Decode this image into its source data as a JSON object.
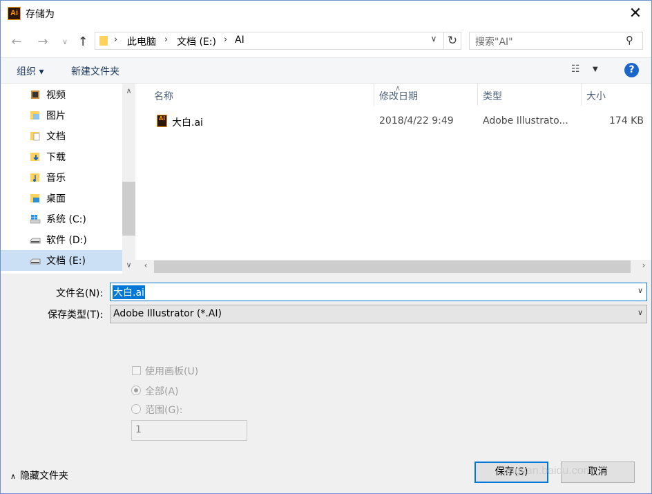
{
  "window": {
    "title": "存储为",
    "app_icon": "Ai"
  },
  "nav": {
    "breadcrumbs": [
      "此电脑",
      "文档 (E:)",
      "AI"
    ],
    "search_placeholder": "搜索\"AI\""
  },
  "toolbar": {
    "organize": "组织 ▾",
    "new_folder": "新建文件夹"
  },
  "tree": {
    "items": [
      {
        "label": "视频",
        "icon": "video-folder-icon"
      },
      {
        "label": "图片",
        "icon": "pictures-folder-icon"
      },
      {
        "label": "文档",
        "icon": "documents-folder-icon"
      },
      {
        "label": "下载",
        "icon": "downloads-folder-icon"
      },
      {
        "label": "音乐",
        "icon": "music-folder-icon"
      },
      {
        "label": "桌面",
        "icon": "desktop-folder-icon"
      },
      {
        "label": "系统 (C:)",
        "icon": "system-drive-icon"
      },
      {
        "label": "软件 (D:)",
        "icon": "drive-icon"
      },
      {
        "label": "文档 (E:)",
        "icon": "drive-icon",
        "selected": true
      }
    ]
  },
  "list": {
    "columns": [
      "名称",
      "修改日期",
      "类型",
      "大小"
    ],
    "rows": [
      {
        "name": "大白.ai",
        "modified": "2018/4/22 9:49",
        "type": "Adobe Illustrato...",
        "size": "174 KB"
      }
    ]
  },
  "form": {
    "filename_label": "文件名(N):",
    "filename_value": "大白.ai",
    "filetype_label": "保存类型(T):",
    "filetype_value": "Adobe Illustrator (*.AI)",
    "use_artboards": "使用画板(U)",
    "all": "全部(A)",
    "range": "范围(G):",
    "range_value": "1"
  },
  "footer": {
    "hide_folders": "隐藏文件夹",
    "save": "保存(S)",
    "cancel": "取消",
    "watermark": "jingyan.baidu.com"
  },
  "colors": {
    "accent": "#0078d7",
    "selection": "#cce0f5",
    "help": "#1b65c9"
  }
}
